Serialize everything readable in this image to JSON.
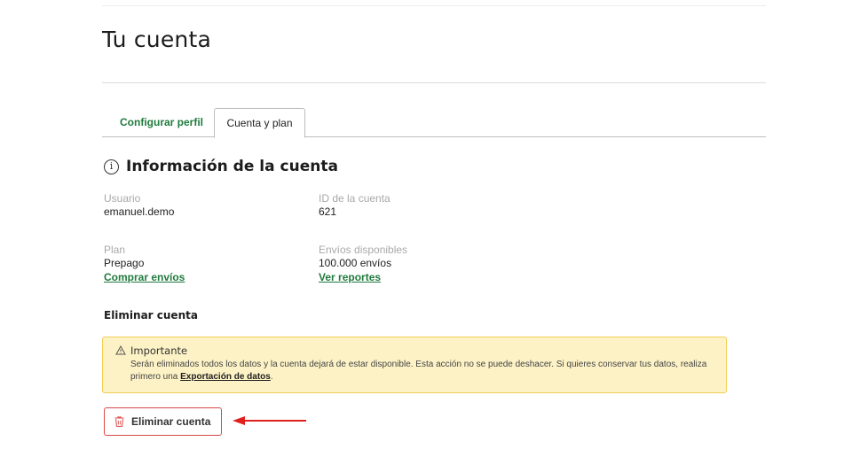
{
  "page": {
    "title": "Tu cuenta"
  },
  "tabs": [
    {
      "label": "Configurar perfil",
      "active": false
    },
    {
      "label": "Cuenta y plan",
      "active": true
    }
  ],
  "account_info": {
    "heading": "Información de la cuenta",
    "icon": "info-icon",
    "user_label": "Usuario",
    "user_value": "emanuel.demo",
    "account_id_label": "ID de la cuenta",
    "account_id_value": "621",
    "plan_label": "Plan",
    "plan_value": "Prepago",
    "buy_link": "Comprar envíos",
    "sends_label": "Envíos disponibles",
    "sends_value": "100.000 envíos",
    "reports_link": "Ver reportes"
  },
  "delete_section": {
    "heading": "Eliminar cuenta",
    "alert_icon": "warning-icon",
    "alert_title": "Importante",
    "alert_text": "Serán eliminados todos los datos y la cuenta dejará de estar disponible. Esta acción no se puede deshacer. Si quieres conservar tus datos, realiza primero una ",
    "alert_link": "Exportación de datos",
    "alert_text_end": ".",
    "button_label": "Eliminar cuenta",
    "button_icon": "trash-icon"
  },
  "colors": {
    "accent_green": "#1f7a3c",
    "danger_red": "#d84848",
    "alert_bg": "#fdf2c6",
    "alert_border": "#f2cf55",
    "arrow_red": "#e01f1f"
  }
}
